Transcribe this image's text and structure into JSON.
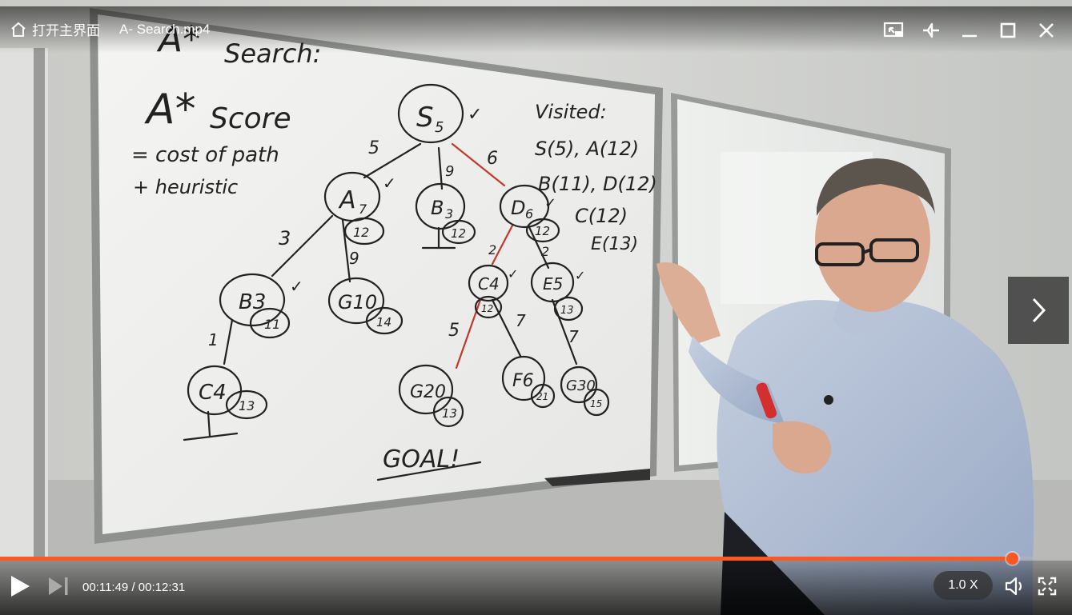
{
  "player": {
    "home_label": "打开主界面",
    "file_title": "A- Search.mp4",
    "current_time": "00:11:49",
    "separator": " / ",
    "total_time": "00:12:31",
    "speed_label": "1.0 X",
    "progress_percent": 94.4,
    "accent_color": "#ff5722"
  },
  "icons": {
    "home": "home-icon",
    "pip": "picture-in-picture-icon",
    "pin": "pin-icon",
    "minimize": "minimize-icon",
    "maximize": "maximize-icon",
    "close": "close-icon",
    "next_arrow": "chevron-right-icon",
    "play": "play-icon",
    "skip": "skip-next-icon",
    "volume": "volume-icon",
    "fullscreen": "fullscreen-icon"
  },
  "whiteboard": {
    "title": "A* Search:",
    "score_heading": "A*  Score",
    "formula_line1": "= cost of path",
    "formula_line2": "+ heuristic",
    "visited_heading": "Visited:",
    "visited_lines": [
      "S(5), A(12)",
      "B(11), D(12)",
      "C(12)",
      "E(13)"
    ],
    "goal_label": "GOAL!",
    "nodes": [
      {
        "label": "S5"
      },
      {
        "label": "A7",
        "score": "12"
      },
      {
        "label": "B3",
        "score": "12"
      },
      {
        "label": "D6",
        "score": "12"
      },
      {
        "label": "B3",
        "score": "11"
      },
      {
        "label": "G10",
        "score": "14"
      },
      {
        "label": "C4",
        "score": "12"
      },
      {
        "label": "E5",
        "score": "13"
      },
      {
        "label": "C4",
        "score": "13"
      },
      {
        "label": "G20",
        "score": "13"
      },
      {
        "label": "F6",
        "score": "21"
      },
      {
        "label": "G30",
        "score": "15"
      }
    ],
    "edge_costs": [
      "5",
      "9",
      "6",
      "3",
      "9",
      "2",
      "2",
      "1",
      "5",
      "7",
      "7"
    ]
  }
}
